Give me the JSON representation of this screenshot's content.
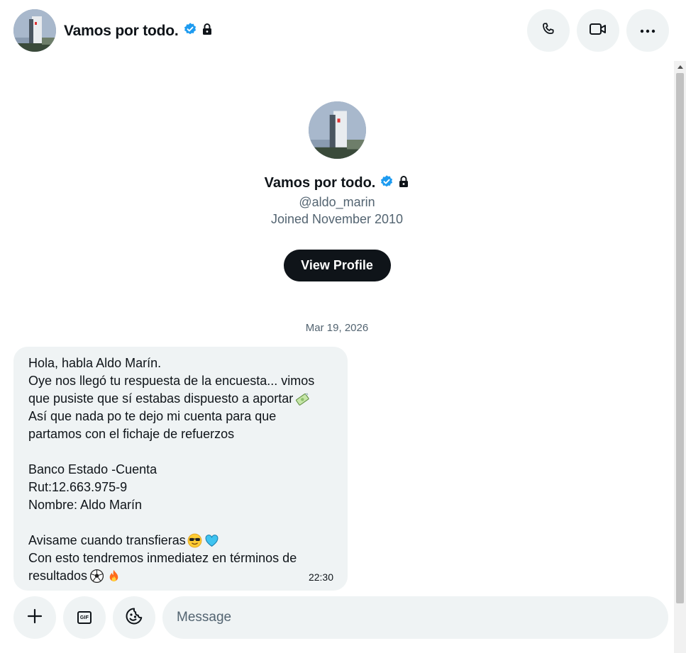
{
  "header": {
    "title": "Vamos por todo.",
    "avatar_icon": "building-photo-avatar",
    "verified_icon": "verified-badge-icon",
    "protected_icon": "lock-icon",
    "actions": [
      "phone-icon",
      "video-icon",
      "more-icon"
    ]
  },
  "profile": {
    "name": "Vamos por todo.",
    "handle": "@aldo_marin",
    "joined": "Joined November 2010",
    "view_button": "View Profile"
  },
  "conversation": {
    "date": "Mar 19, 2026",
    "message": {
      "lines": [
        "Hola, habla Aldo Marín.",
        "Oye nos llegó tu respuesta de la encuesta... vimos",
        "que pusiste que sí estabas dispuesto a aportar",
        "Así que nada po te dejo mi cuenta para que",
        "partamos con el fichaje de refuerzos",
        "",
        "Banco Estado -Cuenta",
        "Rut:12.663.975-9",
        "Nombre: Aldo Marín",
        "",
        "Avisame cuando transfieras",
        "Con esto tendremos inmediatez en términos de",
        "resultados"
      ],
      "time": "22:30"
    }
  },
  "composer": {
    "placeholder": "Message",
    "add_icon": "plus-icon",
    "gif_label": "GIF",
    "emoji_icon": "emoji-icon"
  },
  "colors": {
    "accent_verified": "#1d9bf0",
    "bubble_bg": "#eff3f4",
    "button_dark": "#0f1419",
    "secondary_text": "#536471"
  }
}
